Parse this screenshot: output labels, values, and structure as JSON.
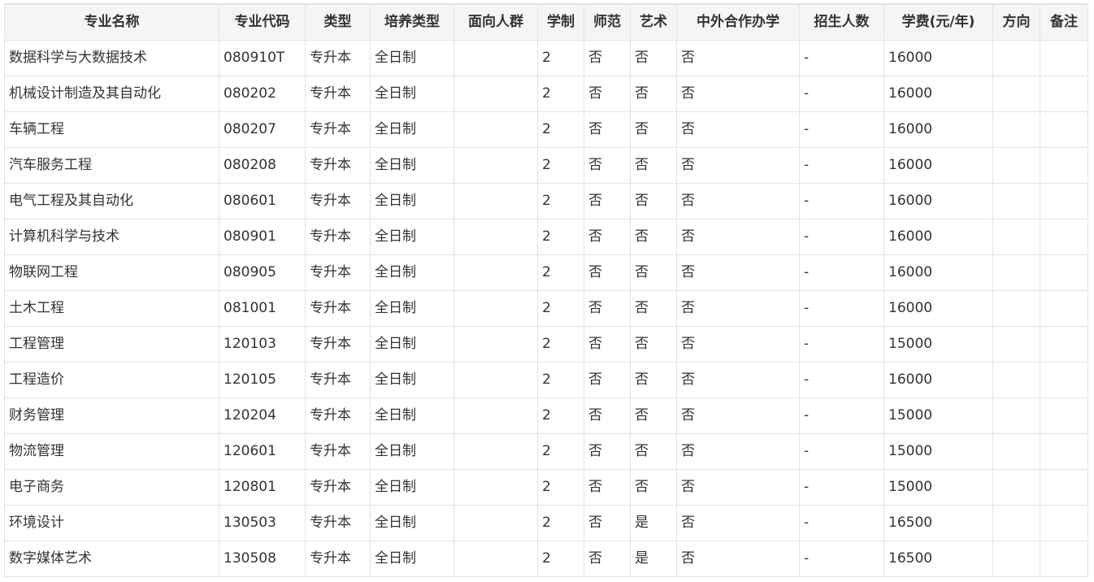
{
  "table": {
    "headers": [
      "专业名称",
      "专业代码",
      "类型",
      "培养类型",
      "面向人群",
      "学制",
      "师范",
      "艺术",
      "中外合作办学",
      "招生人数",
      "学费(元/年)",
      "方向",
      "备注"
    ],
    "rows": [
      [
        "数据科学与大数据技术",
        "080910T",
        "专升本",
        "全日制",
        "",
        "2",
        "否",
        "否",
        "否",
        "-",
        "16000",
        "",
        ""
      ],
      [
        "机械设计制造及其自动化",
        "080202",
        "专升本",
        "全日制",
        "",
        "2",
        "否",
        "否",
        "否",
        "-",
        "16000",
        "",
        ""
      ],
      [
        "车辆工程",
        "080207",
        "专升本",
        "全日制",
        "",
        "2",
        "否",
        "否",
        "否",
        "-",
        "16000",
        "",
        ""
      ],
      [
        "汽车服务工程",
        "080208",
        "专升本",
        "全日制",
        "",
        "2",
        "否",
        "否",
        "否",
        "-",
        "16000",
        "",
        ""
      ],
      [
        "电气工程及其自动化",
        "080601",
        "专升本",
        "全日制",
        "",
        "2",
        "否",
        "否",
        "否",
        "-",
        "16000",
        "",
        ""
      ],
      [
        "计算机科学与技术",
        "080901",
        "专升本",
        "全日制",
        "",
        "2",
        "否",
        "否",
        "否",
        "-",
        "16000",
        "",
        ""
      ],
      [
        "物联网工程",
        "080905",
        "专升本",
        "全日制",
        "",
        "2",
        "否",
        "否",
        "否",
        "-",
        "16000",
        "",
        ""
      ],
      [
        "土木工程",
        "081001",
        "专升本",
        "全日制",
        "",
        "2",
        "否",
        "否",
        "否",
        "-",
        "16000",
        "",
        ""
      ],
      [
        "工程管理",
        "120103",
        "专升本",
        "全日制",
        "",
        "2",
        "否",
        "否",
        "否",
        "-",
        "15000",
        "",
        ""
      ],
      [
        "工程造价",
        "120105",
        "专升本",
        "全日制",
        "",
        "2",
        "否",
        "否",
        "否",
        "-",
        "16000",
        "",
        ""
      ],
      [
        "财务管理",
        "120204",
        "专升本",
        "全日制",
        "",
        "2",
        "否",
        "否",
        "否",
        "-",
        "15000",
        "",
        ""
      ],
      [
        "物流管理",
        "120601",
        "专升本",
        "全日制",
        "",
        "2",
        "否",
        "否",
        "否",
        "-",
        "15000",
        "",
        ""
      ],
      [
        "电子商务",
        "120801",
        "专升本",
        "全日制",
        "",
        "2",
        "否",
        "否",
        "否",
        "-",
        "15000",
        "",
        ""
      ],
      [
        "环境设计",
        "130503",
        "专升本",
        "全日制",
        "",
        "2",
        "否",
        "是",
        "否",
        "-",
        "16500",
        "",
        ""
      ],
      [
        "数字媒体艺术",
        "130508",
        "专升本",
        "全日制",
        "",
        "2",
        "否",
        "是",
        "否",
        "-",
        "16500",
        "",
        ""
      ]
    ]
  }
}
